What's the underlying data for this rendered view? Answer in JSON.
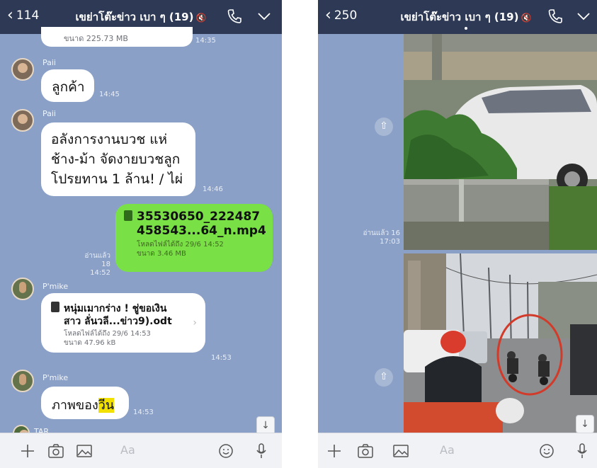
{
  "left": {
    "header": {
      "back_count": "114",
      "title": "เขย่าโต๊ะข่าว เบา ๆ (19)",
      "mute_glyph": "🔇"
    },
    "messages": {
      "partial_size": "ขนาด 225.73 MB",
      "partial_time": "14:35",
      "m1_sender": "Paii",
      "m1_text": "ลูกค้า",
      "m1_time": "14:45",
      "m2_sender": "Paii",
      "m2_line1": "อลังการงานบวช แห่",
      "m2_line2": "ช้าง-ม้า จัดงายบวชลูก",
      "m2_line3": "โปรยทาน 1 ล้าน! / ไผ่",
      "m2_time": "14:46",
      "m3_name1": "35530650_222487",
      "m3_name2": "458543...64_n.mp4",
      "m3_dl": "โหลดไฟล์ได้ถึง 29/6 14:52",
      "m3_size": "ขนาด 3.46 MB",
      "m3_read": "อ่านแล้ว 18",
      "m3_time": "14:52",
      "m4_sender": "P'mike",
      "m4_name1": "หนุ่มเมากร่าง ! ชู่ขอเงิน",
      "m4_name2": "สาว ลั่นวลี...ข่าว9).odt",
      "m4_dl": "โหลดไฟล์ได้ถึง 29/6 14:53",
      "m4_size": "ขนาด 47.96 kB",
      "m4_time": "14:53",
      "m5_sender": "P'mike",
      "m5_text_a": "ภาพของ",
      "m5_text_b": "วีน",
      "m5_time": "14:53",
      "m6_sender": "TAR"
    },
    "input_placeholder": "Aa"
  },
  "right": {
    "header": {
      "back_count": "250",
      "title": "เขย่าโต๊ะข่าว เบา ๆ (19)",
      "mute_glyph": "🔇"
    },
    "photo1_read": "อ่านแล้ว 16",
    "photo1_time": "17:03",
    "input_placeholder": "Aa"
  },
  "colors": {
    "header": "#2e3a55",
    "chat_bg": "#8aa0c6",
    "sent_bubble": "#79e046",
    "highlight": "#f2e000"
  }
}
